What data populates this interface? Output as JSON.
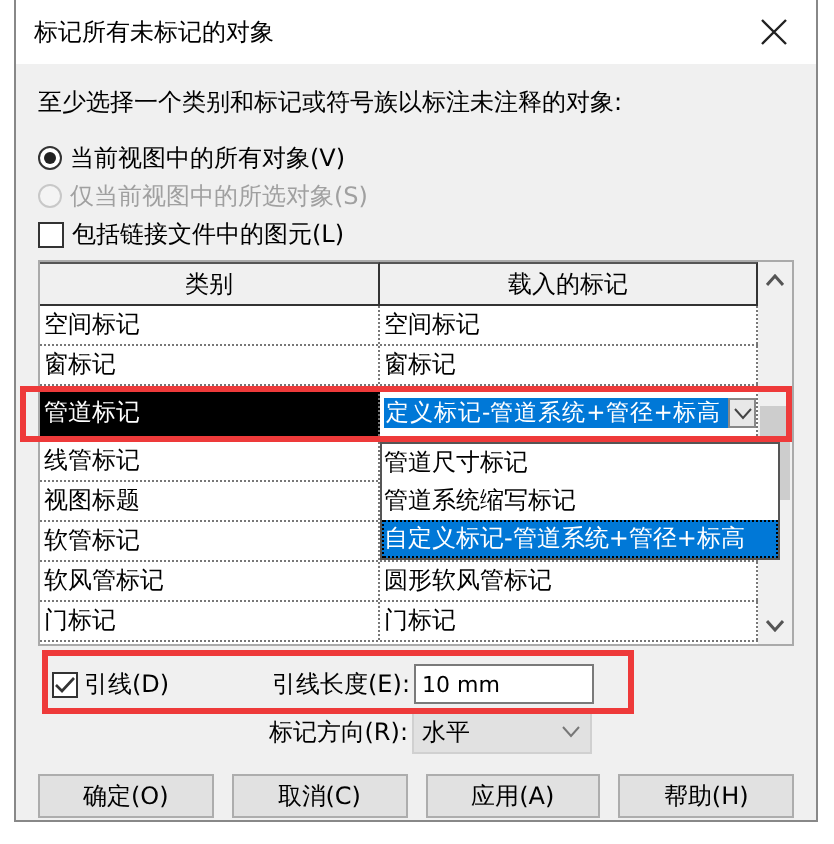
{
  "window": {
    "title": "标记所有未标记的对象"
  },
  "instruction": "至少选择一个类别和标记或符号族以标注未注释的对象:",
  "scope_options": [
    {
      "label": "当前视图中的所有对象(V)",
      "selected": true,
      "disabled": false
    },
    {
      "label": "仅当前视图中的所选对象(S)",
      "selected": false,
      "disabled": true
    }
  ],
  "include_linked": {
    "label": "包括链接文件中的图元(L)",
    "checked": false
  },
  "table": {
    "columns": [
      "类别",
      "载入的标记"
    ],
    "rows": [
      {
        "category": "空间标记",
        "tag": "空间标记",
        "selected": false
      },
      {
        "category": "窗标记",
        "tag": "窗标记",
        "selected": false
      },
      {
        "category": "管道标记",
        "selected": true
      },
      {
        "category": "线管标记",
        "selected": false
      },
      {
        "category": "视图标题",
        "selected": false
      },
      {
        "category": "软管标记",
        "selected": false
      },
      {
        "category": "软风管标记",
        "tag": "圆形软风管标记",
        "selected": false
      },
      {
        "category": "门标记",
        "tag": "门标记",
        "selected": false
      }
    ],
    "tag_dropdown": {
      "value": "定义标记-管道系统+管径+标高",
      "options": [
        {
          "label": "管道尺寸标记",
          "selected": false
        },
        {
          "label": "管道系统缩写标记",
          "selected": false
        },
        {
          "label": "自定义标记-管道系统+管径+标高",
          "selected": true
        }
      ]
    }
  },
  "leader": {
    "label": "引线(D)",
    "checked": true
  },
  "leader_length": {
    "label": "引线长度(E):",
    "value": "10 mm"
  },
  "tag_orientation": {
    "label": "标记方向(R):",
    "value": "水平"
  },
  "buttons": [
    "确定(O)",
    "取消(C)",
    "应用(A)",
    "帮助(H)"
  ]
}
